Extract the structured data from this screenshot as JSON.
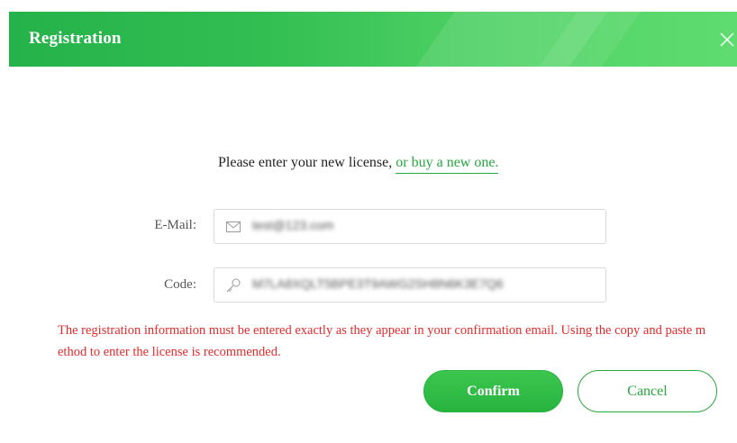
{
  "dialog": {
    "title": "Registration",
    "prompt_text": "Please enter your new license, ",
    "buy_link": "or buy a new one.",
    "email_label": "E-Mail:",
    "email_value": "test@123.com",
    "code_label": "Code:",
    "code_value": "M7LA8XQLT5BPE3T9AWG2SH8N6K3E7Q6",
    "warning": "The registration information must be entered exactly as they appear in your confirmation email. Using the copy and paste method to enter the license is recommended.",
    "confirm_label": "Confirm",
    "cancel_label": "Cancel"
  },
  "colors": {
    "accent": "#27b43e",
    "warning": "#e22c2c",
    "title_text": "#ffffff"
  },
  "icons": {
    "close": "close-icon",
    "email": "envelope-icon",
    "code": "key-icon"
  }
}
